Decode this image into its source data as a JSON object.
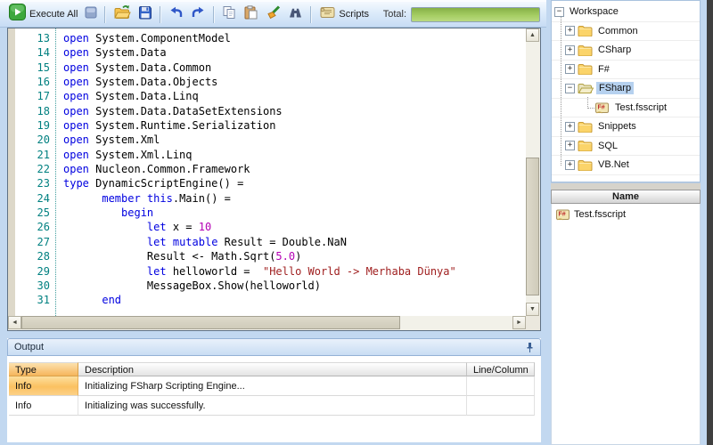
{
  "toolbar": {
    "execute_all_label": "Execute All",
    "scripts_label": "Scripts",
    "total_label": "Total:",
    "progress_percent": 100,
    "progress_color": "#a5cd63"
  },
  "editor": {
    "colors": {
      "k": "#0000e0",
      "p": "#000000",
      "n": "#b400b4",
      "s": "#a02020",
      "line_number": "#008080"
    },
    "lines": [
      {
        "number": 13,
        "segments": [
          [
            "k",
            "open"
          ],
          [
            "p",
            " System.ComponentModel"
          ]
        ]
      },
      {
        "number": 14,
        "segments": [
          [
            "k",
            "open"
          ],
          [
            "p",
            " System.Data"
          ]
        ]
      },
      {
        "number": 15,
        "segments": [
          [
            "k",
            "open"
          ],
          [
            "p",
            " System.Data.Common"
          ]
        ]
      },
      {
        "number": 16,
        "segments": [
          [
            "k",
            "open"
          ],
          [
            "p",
            " System.Data.Objects"
          ]
        ]
      },
      {
        "number": 17,
        "segments": [
          [
            "k",
            "open"
          ],
          [
            "p",
            " System.Data.Linq"
          ]
        ]
      },
      {
        "number": 18,
        "segments": [
          [
            "k",
            "open"
          ],
          [
            "p",
            " System.Data.DataSetExtensions"
          ]
        ]
      },
      {
        "number": 19,
        "segments": [
          [
            "k",
            "open"
          ],
          [
            "p",
            " System.Runtime.Serialization"
          ]
        ]
      },
      {
        "number": 20,
        "segments": [
          [
            "k",
            "open"
          ],
          [
            "p",
            " System.Xml"
          ]
        ]
      },
      {
        "number": 21,
        "segments": [
          [
            "k",
            "open"
          ],
          [
            "p",
            " System.Xml.Linq"
          ]
        ]
      },
      {
        "number": 22,
        "segments": [
          [
            "k",
            "open"
          ],
          [
            "p",
            " Nucleon.Common.Framework"
          ]
        ]
      },
      {
        "number": 23,
        "segments": [
          [
            "k",
            "type"
          ],
          [
            "p",
            " DynamicScriptEngine() ="
          ]
        ]
      },
      {
        "number": 24,
        "segments": [
          [
            "p",
            "      "
          ],
          [
            "k",
            "member"
          ],
          [
            "p",
            " "
          ],
          [
            "k",
            "this"
          ],
          [
            "p",
            ".Main() ="
          ]
        ]
      },
      {
        "number": 25,
        "segments": [
          [
            "p",
            "         "
          ],
          [
            "k",
            "begin"
          ]
        ]
      },
      {
        "number": 26,
        "segments": [
          [
            "p",
            "             "
          ],
          [
            "k",
            "let"
          ],
          [
            "p",
            " x = "
          ],
          [
            "n",
            "10"
          ]
        ]
      },
      {
        "number": 27,
        "segments": [
          [
            "p",
            "             "
          ],
          [
            "k",
            "let"
          ],
          [
            "p",
            " "
          ],
          [
            "k",
            "mutable"
          ],
          [
            "p",
            " Result = Double.NaN"
          ]
        ]
      },
      {
        "number": 28,
        "segments": [
          [
            "p",
            "             Result <- Math.Sqrt("
          ],
          [
            "n",
            "5.0"
          ],
          [
            "p",
            ")"
          ]
        ]
      },
      {
        "number": 29,
        "segments": [
          [
            "p",
            "             "
          ],
          [
            "k",
            "let"
          ],
          [
            "p",
            " helloworld =  "
          ],
          [
            "s",
            "\"Hello World -> Merhaba Dünya\""
          ]
        ]
      },
      {
        "number": 30,
        "segments": [
          [
            "p",
            "             MessageBox.Show(helloworld)"
          ]
        ]
      },
      {
        "number": 31,
        "segments": [
          [
            "p",
            "      "
          ],
          [
            "k",
            "end"
          ]
        ]
      }
    ]
  },
  "workspace_tree": {
    "root_label": "Workspace",
    "items": [
      {
        "label": "Common",
        "icon": "folder-closed-icon",
        "expander": "plus"
      },
      {
        "label": "CSharp",
        "icon": "folder-closed-icon",
        "expander": "plus"
      },
      {
        "label": "F#",
        "icon": "folder-closed-icon",
        "expander": "plus"
      },
      {
        "label": "FSharp",
        "icon": "folder-open-icon",
        "expander": "minus",
        "selected": true,
        "children": [
          {
            "label": "Test.fsscript",
            "icon": "fsharp-script-icon"
          }
        ]
      },
      {
        "label": "Snippets",
        "icon": "folder-closed-icon",
        "expander": "plus"
      },
      {
        "label": "SQL",
        "icon": "folder-closed-icon",
        "expander": "plus"
      },
      {
        "label": "VB.Net",
        "icon": "folder-closed-icon",
        "expander": "plus"
      }
    ]
  },
  "name_panel": {
    "header": "Name",
    "items": [
      {
        "label": "Test.fsscript",
        "icon": "fsharp-script-icon"
      }
    ]
  },
  "output": {
    "title": "Output",
    "columns": [
      "Type",
      "Description",
      "Line/Column"
    ],
    "status_orange": "#f6b55c",
    "rows": [
      {
        "type": "Info",
        "description": "Initializing FSharp Scripting Engine...",
        "line_column": "",
        "highlight": true
      },
      {
        "type": "Info",
        "description": "Initializing was successfully.",
        "line_column": "",
        "highlight": false
      }
    ]
  }
}
